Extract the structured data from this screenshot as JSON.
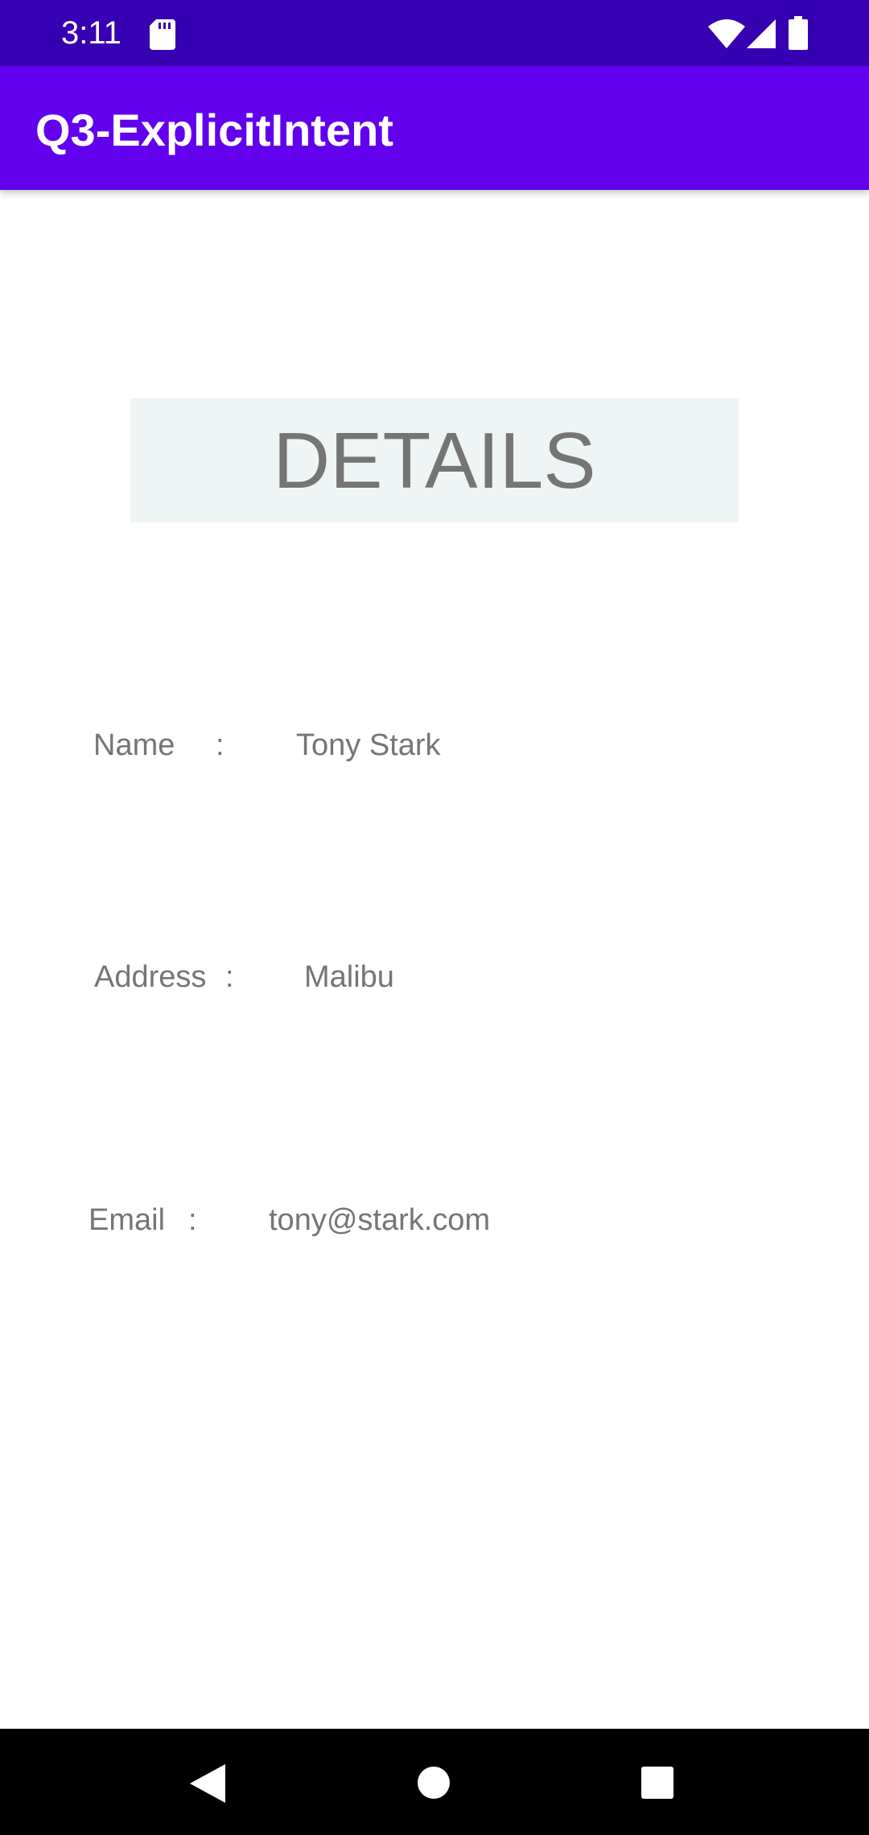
{
  "status_bar": {
    "time": "3:11",
    "icons": [
      "sd-card-icon",
      "wifi-icon",
      "signal-icon",
      "battery-icon"
    ]
  },
  "app_bar": {
    "title": "Q3-ExplicitIntent",
    "color": "#6200ee",
    "status_color": "#3700b3"
  },
  "details": {
    "heading": "DETAILS"
  },
  "fields": {
    "name": {
      "label": "Name",
      "separator": ":",
      "value": "Tony Stark"
    },
    "address": {
      "label": "Address",
      "separator": ":",
      "value": "Malibu"
    },
    "email": {
      "label": "Email",
      "separator": ":",
      "value": "tony@stark.com"
    }
  },
  "nav_bar": {
    "icons": [
      "back-icon",
      "home-icon",
      "recents-icon"
    ]
  }
}
